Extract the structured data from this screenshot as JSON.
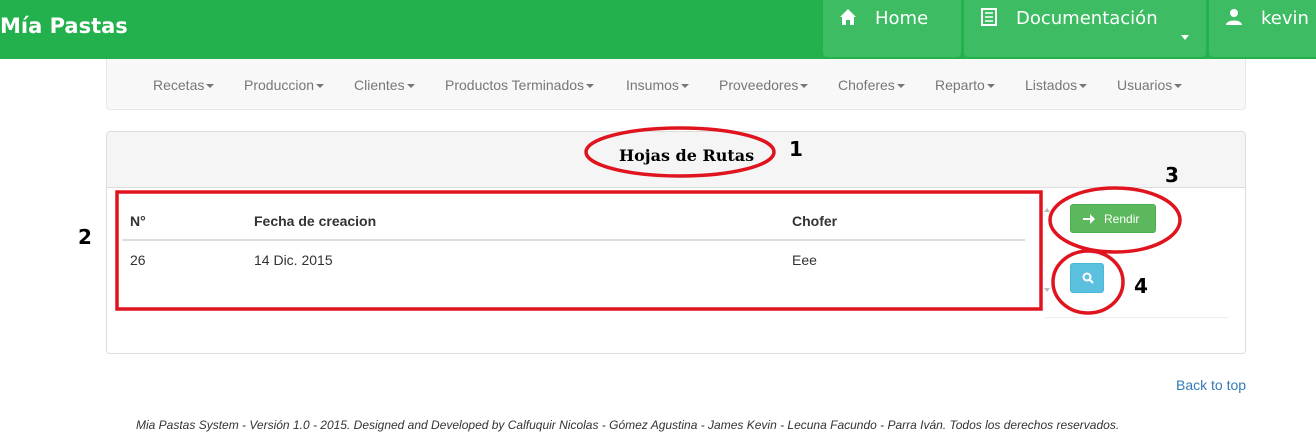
{
  "brand": "Mía Pastas",
  "topnav": {
    "home": "Home",
    "docs": "Documentación",
    "user": "kevin"
  },
  "menu": [
    "Recetas",
    "Produccion",
    "Clientes",
    "Productos Terminados",
    "Insumos",
    "Proveedores",
    "Choferes",
    "Reparto",
    "Listados",
    "Usuarios"
  ],
  "panel": {
    "title": "Hojas de Rutas",
    "columns": [
      "N°",
      "Fecha de creacion",
      "Chofer"
    ],
    "rows": [
      {
        "n": "26",
        "fecha": "14 Dic. 2015",
        "chofer": "Eee"
      }
    ],
    "rendir_label": "Rendir"
  },
  "back_to_top": "Back to top",
  "footer": "Mia Pastas System - Versión 1.0 - 2015. Designed and Developed by Calfuquir Nicolas - Gómez Agustina - James Kevin - Lecuna Facundo - Parra Iván. Todos los derechos reservados.",
  "annotations": [
    "1",
    "2",
    "3",
    "4"
  ],
  "colors": {
    "brand_green": "#23b14d",
    "annotation_red": "#e0141e",
    "success": "#5cb85c",
    "info": "#5bc0de"
  }
}
